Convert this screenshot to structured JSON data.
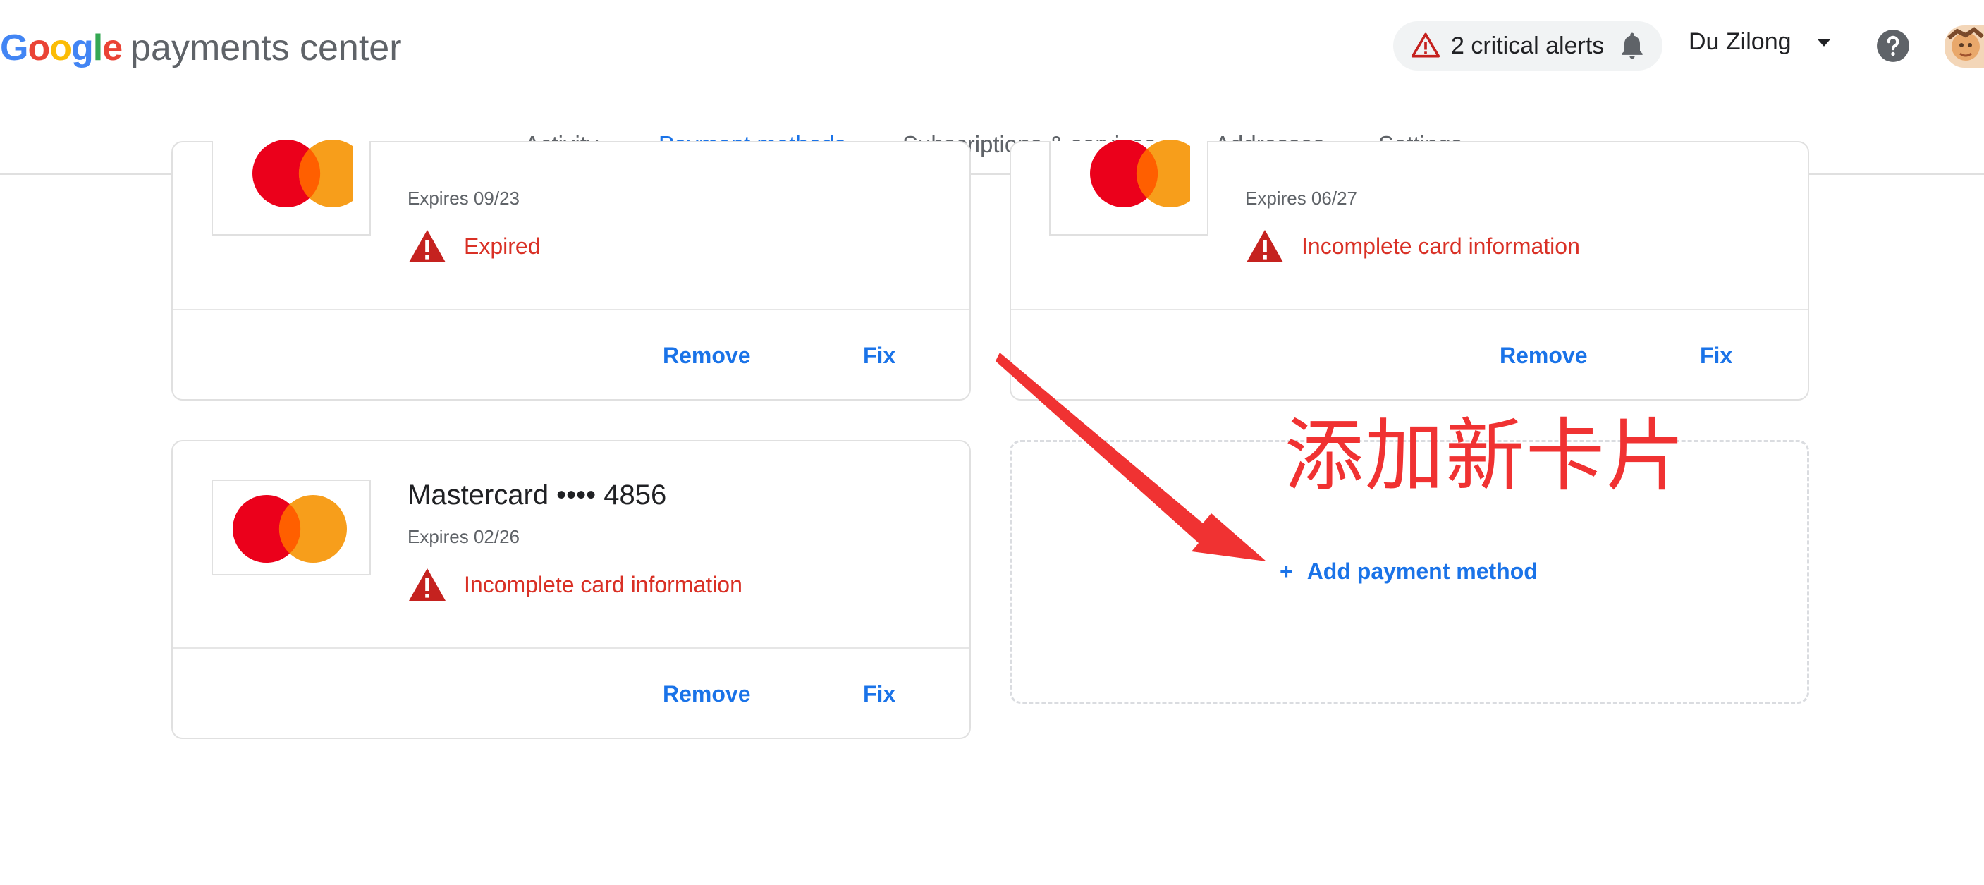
{
  "header": {
    "brand_prefix": "Google",
    "brand_suffix": "payments center",
    "alerts_label": "2 critical alerts",
    "user_name": "Du Zilong"
  },
  "nav": {
    "tabs": [
      {
        "label": "Activity"
      },
      {
        "label": "Payment methods",
        "active": true
      },
      {
        "label": "Subscriptions & services"
      },
      {
        "label": "Addresses"
      },
      {
        "label": "Settings"
      }
    ]
  },
  "cards": [
    {
      "expires": "Expires 09/23",
      "status": "Expired",
      "remove": "Remove",
      "fix": "Fix"
    },
    {
      "expires": "Expires 06/27",
      "status": "Incomplete card information",
      "remove": "Remove",
      "fix": "Fix"
    },
    {
      "title": "Mastercard •••• 4856",
      "expires": "Expires 02/26",
      "status": "Incomplete card information",
      "remove": "Remove",
      "fix": "Fix"
    }
  ],
  "add_card": {
    "plus": "+",
    "label": "Add payment method"
  },
  "annotation": {
    "text": "添加新卡片",
    "color": "#f03232"
  },
  "colors": {
    "accent": "#1a73e8",
    "error": "#d93025",
    "mc_red": "#eb001b",
    "mc_orange": "#f79e1b"
  },
  "icons": [
    "warning-triangle-icon",
    "bell-icon",
    "chevron-down-icon",
    "help-icon",
    "avatar",
    "mastercard-logo"
  ]
}
